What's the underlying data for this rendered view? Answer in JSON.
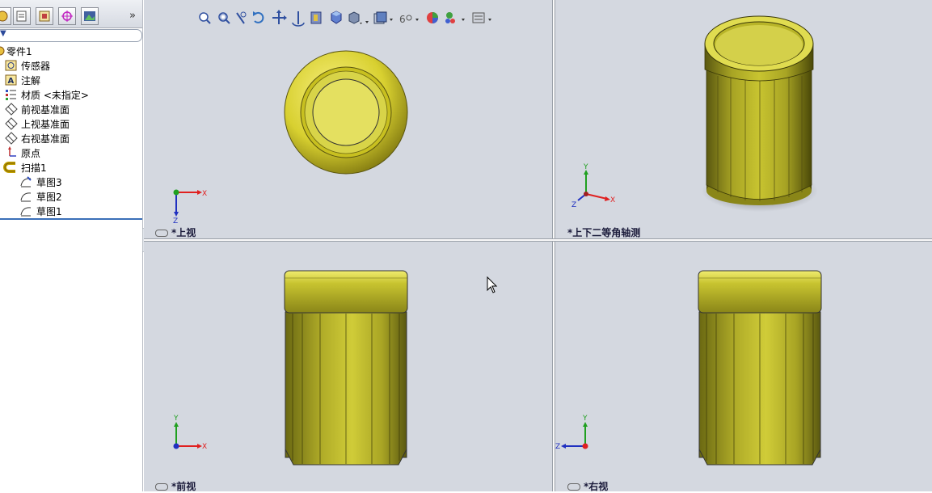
{
  "sidebar": {
    "tabs": [
      "feature-manager",
      "property-manager",
      "configuration-manager",
      "dimxpert-manager",
      "display-manager"
    ],
    "more": "»",
    "tree": [
      {
        "label": "零件1",
        "icon": "part-icon",
        "indent": 0
      },
      {
        "label": "传感器",
        "icon": "sensor-icon",
        "indent": 1
      },
      {
        "label": "注解",
        "icon": "annotation-icon",
        "indent": 1
      },
      {
        "label": "材质 <未指定>",
        "icon": "material-icon",
        "indent": 1
      },
      {
        "label": "前视基准面",
        "icon": "plane-icon",
        "indent": 1
      },
      {
        "label": "上视基准面",
        "icon": "plane-icon",
        "indent": 1
      },
      {
        "label": "右视基准面",
        "icon": "plane-icon",
        "indent": 1
      },
      {
        "label": "原点",
        "icon": "origin-icon",
        "indent": 1
      },
      {
        "label": "扫描1",
        "icon": "sweep-icon",
        "indent": 1
      },
      {
        "label": "草图3",
        "icon": "sketch-icon",
        "indent": 2
      },
      {
        "label": "草图2",
        "icon": "sketch-icon",
        "indent": 2
      },
      {
        "label": "草图1",
        "icon": "sketch-icon",
        "indent": 2
      }
    ]
  },
  "viewports": {
    "top_left": "*上视",
    "top_right": "*上下二等角轴测",
    "bottom_left": "*前视",
    "bottom_right": "*右视"
  },
  "axes": {
    "x": "X",
    "y": "Y",
    "z": "Z"
  },
  "toolbar": [
    "zoom-to-fit-icon",
    "zoom-to-area-icon",
    "previous-view-icon",
    "rotate-icon",
    "pan-icon",
    "roll-icon",
    "section-view-icon",
    "view-orientation-icon",
    "display-style-icon",
    "hide-show-icon",
    "appearance-icon",
    "scene-icon",
    "view-settings-icon"
  ],
  "colors": {
    "model": "#d4d43a",
    "viewport_bg": "#d4d8e0",
    "axis_x": "#e02020",
    "axis_y": "#20a020",
    "axis_z": "#2030c0"
  }
}
